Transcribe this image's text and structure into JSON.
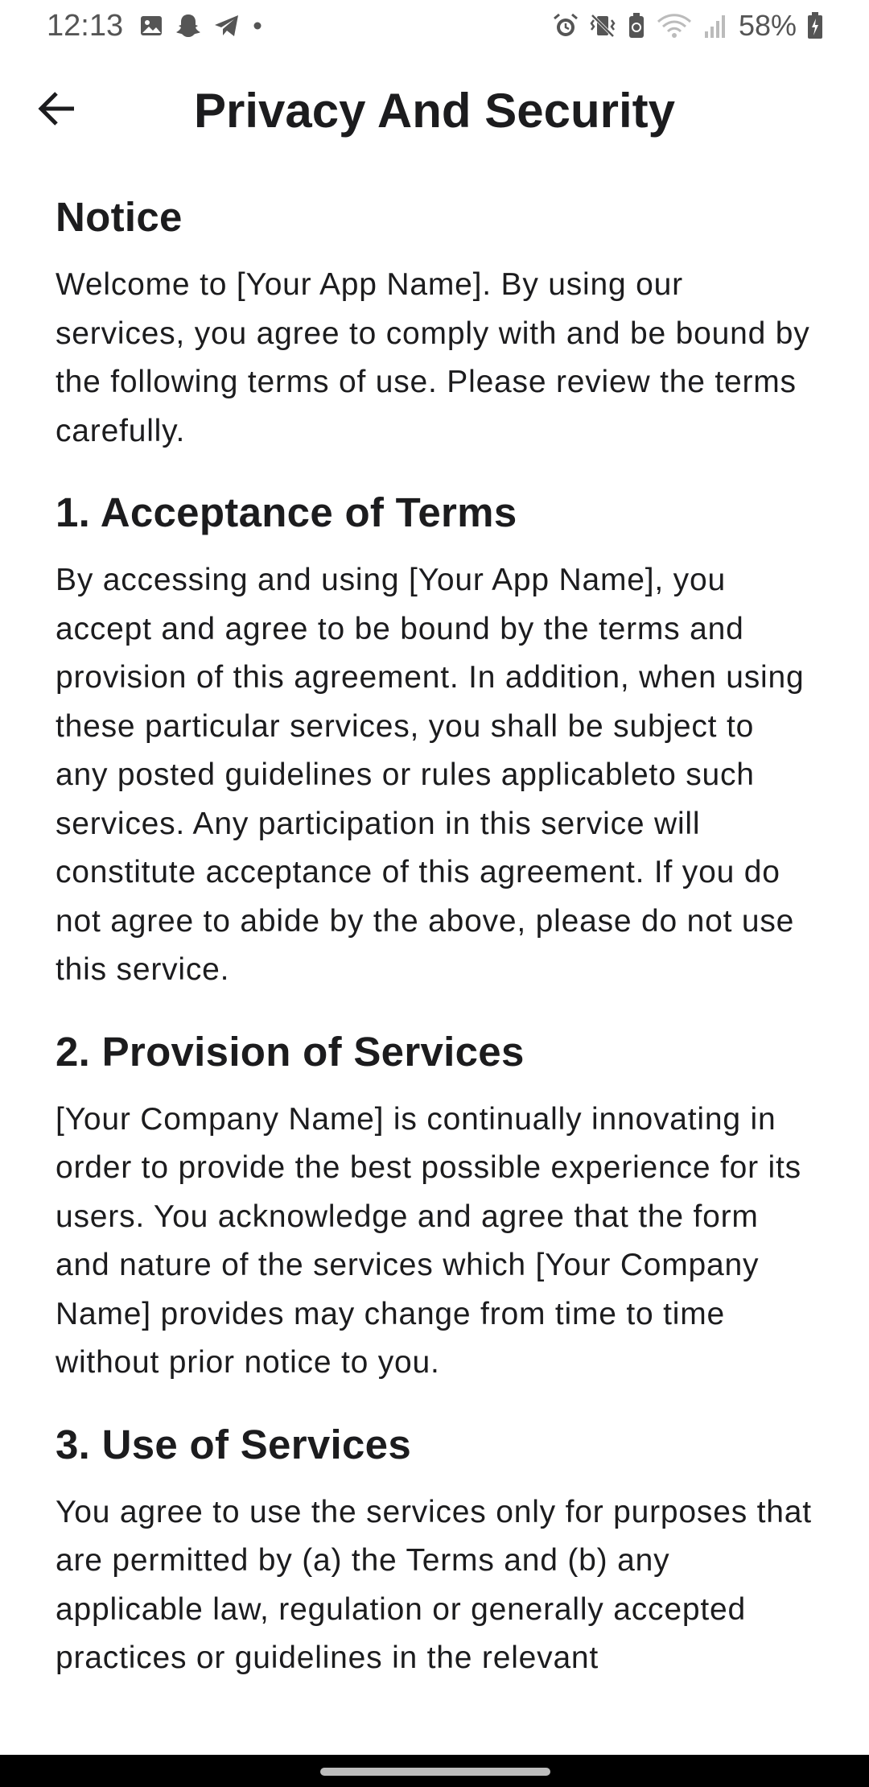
{
  "status_bar": {
    "time": "12:13",
    "battery": "58%",
    "icons_left": [
      "gallery-icon",
      "snapchat-icon",
      "telegram-icon",
      "dot-icon"
    ],
    "icons_right": [
      "alarm-icon",
      "vibrate-icon",
      "battery-saver-icon",
      "wifi-icon",
      "signal-icon",
      "battery-icon"
    ]
  },
  "header": {
    "title": "Privacy And Security",
    "back_icon": "arrow-left-icon"
  },
  "sections": [
    {
      "heading": "Notice",
      "body": "Welcome to [Your App Name]. By using our services, you agree to comply with and be bound by the following terms of use. Please review the terms carefully."
    },
    {
      "heading": "1. Acceptance of Terms",
      "body": "By accessing and using [Your App Name], you accept and agree to be bound by the terms and provision of this agreement. In addition, when using these particular services, you shall be subject to any posted guidelines or rules applicableto such services. Any participation in this service will constitute acceptance of this agreement. If you do not agree to abide by the above, please do not use this service."
    },
    {
      "heading": "2. Provision of Services",
      "body": "[Your Company Name] is continually innovating in order to provide the best possible experience for its users. You acknowledge and agree that the form and nature of the services which [Your Company Name] provides may change from time to time without prior notice to you."
    },
    {
      "heading": "3. Use of Services",
      "body": "You agree to use the services only for purposes that are permitted by (a) the Terms and (b) any applicable law, regulation or generally accepted practices or guidelines in the relevant"
    }
  ],
  "colors": {
    "text": "#1c1c1e",
    "background": "#ffffff",
    "status_text": "#555555",
    "nav_bar": "#000000"
  }
}
